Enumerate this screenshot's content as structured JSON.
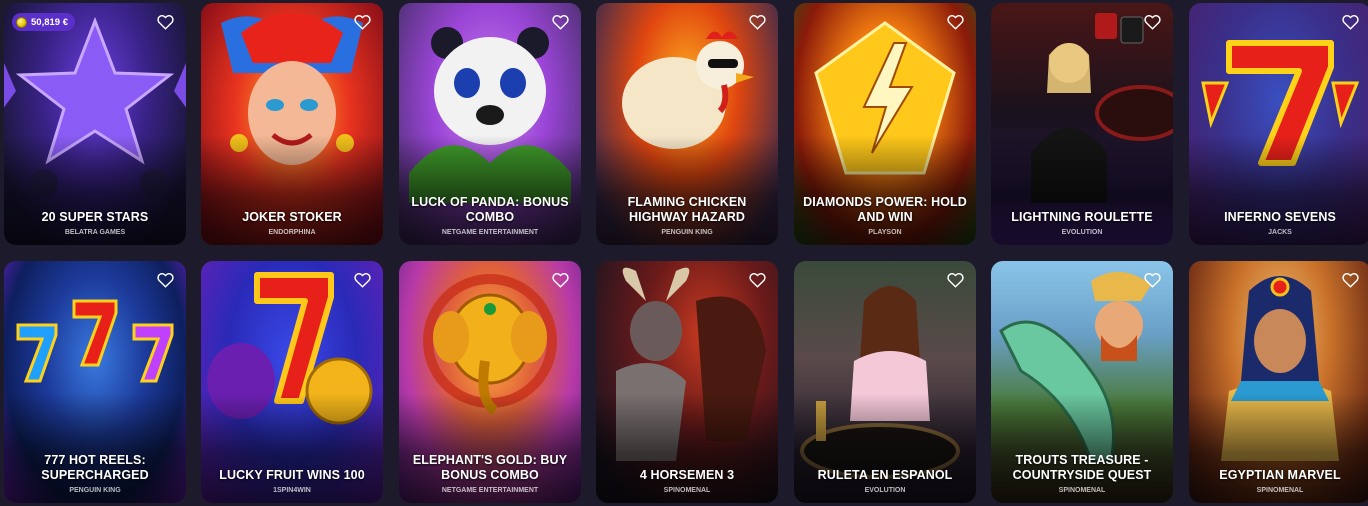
{
  "jackpot_badge": {
    "value": "50,819 €",
    "icon": "coin-icon"
  },
  "games": [
    {
      "title": "20 SUPER STARS",
      "provider": "BELATRA GAMES",
      "favorite_icon": "heart-outline-icon",
      "colors": [
        "#2b1c5e",
        "#5a2fc4",
        "#171533"
      ]
    },
    {
      "title": "JOKER STOKER",
      "provider": "ENDORPHINA",
      "favorite_icon": "heart-outline-icon",
      "colors": [
        "#f2a01f",
        "#d3201c",
        "#8a0f18"
      ]
    },
    {
      "title": "LUCK OF PANDA: BONUS COMBO",
      "provider": "NETGAME ENTERTAINMENT",
      "favorite_icon": "heart-outline-icon",
      "colors": [
        "#b866e8",
        "#8a3fc9",
        "#4a2f6e"
      ]
    },
    {
      "title": "FLAMING CHICKEN HIGHWAY HAZARD",
      "provider": "PENGUIN KING",
      "favorite_icon": "heart-outline-icon",
      "colors": [
        "#ff7a1a",
        "#c42f10",
        "#3a2a4e"
      ]
    },
    {
      "title": "DIAMONDS POWER: HOLD AND WIN",
      "provider": "PLAYSON",
      "favorite_icon": "heart-outline-icon",
      "colors": [
        "#ffd400",
        "#e2500a",
        "#1c5a17"
      ]
    },
    {
      "title": "LIGHTNING ROULETTE",
      "provider": "EVOLUTION",
      "favorite_icon": "heart-outline-icon",
      "colors": [
        "#3a1212",
        "#12101e",
        "#5a2aa8"
      ]
    },
    {
      "title": "INFERNO SEVENS",
      "provider": "JACKS",
      "favorite_icon": "heart-outline-icon",
      "colors": [
        "#2a3e9c",
        "#3f2f8a",
        "#4a1f6a"
      ]
    },
    {
      "title": "777 HOT REELS: SUPERCHARGED",
      "provider": "PENGUIN KING",
      "favorite_icon": "heart-outline-icon",
      "colors": [
        "#0e1f5e",
        "#1c49b8",
        "#7a1fd0"
      ]
    },
    {
      "title": "LUCKY FRUIT WINS 100",
      "provider": "1SPIN4WIN",
      "favorite_icon": "heart-outline-icon",
      "colors": [
        "#1f2fb8",
        "#3a2bb0",
        "#6a1fb5"
      ]
    },
    {
      "title": "ELEPHANT'S GOLD: BUY BONUS COMBO",
      "provider": "NETGAME ENTERTAINMENT",
      "favorite_icon": "heart-outline-icon",
      "colors": [
        "#f07a22",
        "#b83aa8",
        "#5a1f8a"
      ]
    },
    {
      "title": "4 HORSEMEN 3",
      "provider": "SPINOMENAL",
      "favorite_icon": "heart-outline-icon",
      "colors": [
        "#8a1f1a",
        "#3a1a1a",
        "#1a1420"
      ]
    },
    {
      "title": "RULETA EN ESPANOL",
      "provider": "EVOLUTION",
      "favorite_icon": "heart-outline-icon",
      "colors": [
        "#3a4a3a",
        "#6a5a5a",
        "#231c2a"
      ]
    },
    {
      "title": "TROUTS TREASURE - COUNTRYSIDE QUEST",
      "provider": "SPINOMENAL",
      "favorite_icon": "heart-outline-icon",
      "colors": [
        "#8ac4e8",
        "#4a7a3a",
        "#3a2a1a"
      ]
    },
    {
      "title": "EGYPTIAN MARVEL",
      "provider": "SPINOMENAL",
      "favorite_icon": "heart-outline-icon",
      "colors": [
        "#e8a048",
        "#9a4a1a",
        "#3a1a14"
      ]
    }
  ]
}
